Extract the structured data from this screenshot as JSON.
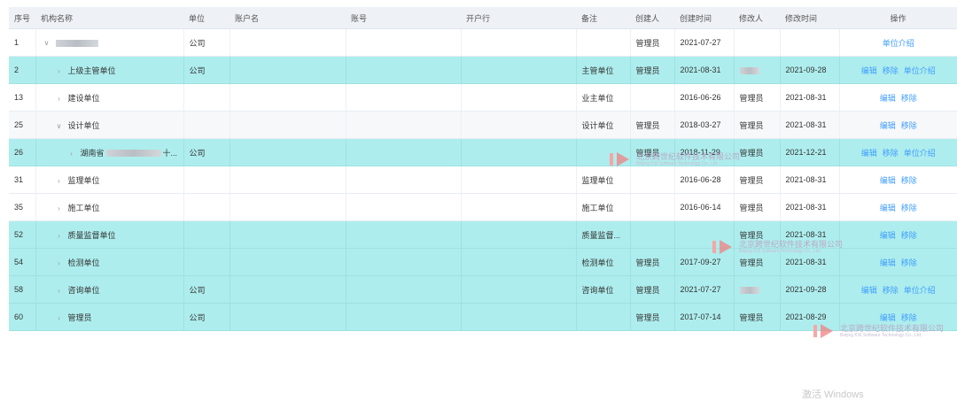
{
  "table": {
    "headers": {
      "seq": "序号",
      "org_name": "机构名称",
      "unit": "单位",
      "account_name": "账户名",
      "account_no": "账号",
      "bank": "开户行",
      "remark": "备注",
      "creator": "创建人",
      "created_at": "创建时间",
      "modifier": "修改人",
      "modified_at": "修改时间",
      "ops": "操作"
    },
    "actions": {
      "edit": "编辑",
      "remove": "移除",
      "intro": "单位介绍"
    },
    "rows": [
      {
        "seq": "1",
        "name": "",
        "expanded": true,
        "level": 0,
        "unit": "公司",
        "remark": "",
        "creator": "管理员",
        "created_at": "2021-07-27",
        "modifier": "",
        "modified_at": "",
        "ops": [
          "intro"
        ],
        "highlight": false,
        "alt": false
      },
      {
        "seq": "2",
        "name": "上级主管单位",
        "expanded": false,
        "level": 1,
        "unit": "公司",
        "remark": "主管单位",
        "creator": "管理员",
        "created_at": "2021-08-31",
        "modifier": "",
        "modified_at": "2021-09-28",
        "ops": [
          "edit",
          "remove",
          "intro"
        ],
        "highlight": true,
        "alt": false
      },
      {
        "seq": "13",
        "name": "建设单位",
        "expanded": false,
        "level": 1,
        "unit": "",
        "remark": "业主单位",
        "creator": "",
        "created_at": "2016-06-26",
        "modifier": "管理员",
        "modified_at": "2021-08-31",
        "ops": [
          "edit",
          "remove"
        ],
        "highlight": false,
        "alt": false
      },
      {
        "seq": "25",
        "name": "设计单位",
        "expanded": true,
        "level": 1,
        "unit": "",
        "remark": "设计单位",
        "creator": "管理员",
        "created_at": "2018-03-27",
        "modifier": "管理员",
        "modified_at": "2021-08-31",
        "ops": [
          "edit",
          "remove"
        ],
        "highlight": false,
        "alt": true
      },
      {
        "seq": "26",
        "name": "湖南省",
        "name_suffix": "十...",
        "expanded": false,
        "level": 2,
        "unit": "公司",
        "remark": "",
        "creator": "管理员",
        "created_at": "2018-11-29",
        "modifier": "管理员",
        "modified_at": "2021-12-21",
        "ops": [
          "edit",
          "remove",
          "intro"
        ],
        "highlight": true,
        "alt": false
      },
      {
        "seq": "31",
        "name": "监理单位",
        "expanded": false,
        "level": 1,
        "unit": "",
        "remark": "监理单位",
        "creator": "",
        "created_at": "2016-06-28",
        "modifier": "管理员",
        "modified_at": "2021-08-31",
        "ops": [
          "edit",
          "remove"
        ],
        "highlight": false,
        "alt": false
      },
      {
        "seq": "35",
        "name": "施工单位",
        "expanded": false,
        "level": 1,
        "unit": "",
        "remark": "施工单位",
        "creator": "",
        "created_at": "2016-06-14",
        "modifier": "管理员",
        "modified_at": "2021-08-31",
        "ops": [
          "edit",
          "remove"
        ],
        "highlight": false,
        "alt": false
      },
      {
        "seq": "52",
        "name": "质量监督单位",
        "expanded": false,
        "level": 1,
        "unit": "",
        "remark": "质量监督...",
        "creator": "",
        "created_at": "",
        "modifier": "管理员",
        "modified_at": "2021-08-31",
        "ops": [
          "edit",
          "remove"
        ],
        "highlight": true,
        "alt": false
      },
      {
        "seq": "54",
        "name": "检测单位",
        "expanded": false,
        "level": 1,
        "unit": "",
        "remark": "检测单位",
        "creator": "管理员",
        "created_at": "2017-09-27",
        "modifier": "管理员",
        "modified_at": "2021-08-31",
        "ops": [
          "edit",
          "remove"
        ],
        "highlight": true,
        "alt": false
      },
      {
        "seq": "58",
        "name": "咨询单位",
        "expanded": false,
        "level": 1,
        "unit": "公司",
        "remark": "咨询单位",
        "creator": "管理员",
        "created_at": "2021-07-27",
        "modifier": "",
        "modified_at": "2021-09-28",
        "ops": [
          "edit",
          "remove",
          "intro"
        ],
        "highlight": true,
        "alt": false
      },
      {
        "seq": "60",
        "name": "管理员",
        "expanded": false,
        "level": 1,
        "unit": "公司",
        "remark": "",
        "creator": "管理员",
        "created_at": "2017-07-14",
        "modifier": "管理员",
        "modified_at": "2021-08-29",
        "ops": [
          "edit",
          "remove"
        ],
        "highlight": true,
        "alt": false
      }
    ]
  },
  "watermark": {
    "cn": "北京跨世纪软件技术有限公司",
    "en": "Beijing KSI Software Technology Co., Ltd."
  },
  "activate_text": "激活 Windows",
  "colors": {
    "highlight_row": "#aeeded",
    "link": "#409eff",
    "header_bg": "#eef1f6"
  }
}
